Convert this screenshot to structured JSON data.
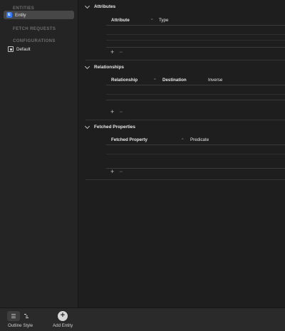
{
  "sidebar": {
    "entities_title": "ENTITIES",
    "entity_badge": "E",
    "entity_name": "Entity",
    "fetch_requests_title": "FETCH REQUESTS",
    "configurations_title": "CONFIGURATIONS",
    "configuration_name": "Default"
  },
  "attributes": {
    "title": "Attributes",
    "col_attribute": "Attribute",
    "col_type": "Type",
    "sort_arrow": "^"
  },
  "relationships": {
    "title": "Relationships",
    "col_relationship": "Relationship",
    "col_destination": "Destination",
    "col_inverse": "Inverse",
    "sort_arrow": "^"
  },
  "fetched_properties": {
    "title": "Fetched Properties",
    "col_fetched_property": "Fetched Property",
    "col_predicate": "Predicate",
    "sort_arrow": "^"
  },
  "controls": {
    "add": "+",
    "remove": "−"
  },
  "toolbar": {
    "outline_style_label": "Outline Style",
    "add_entity_label": "Add Entity",
    "add_entity_glyph": "+"
  }
}
